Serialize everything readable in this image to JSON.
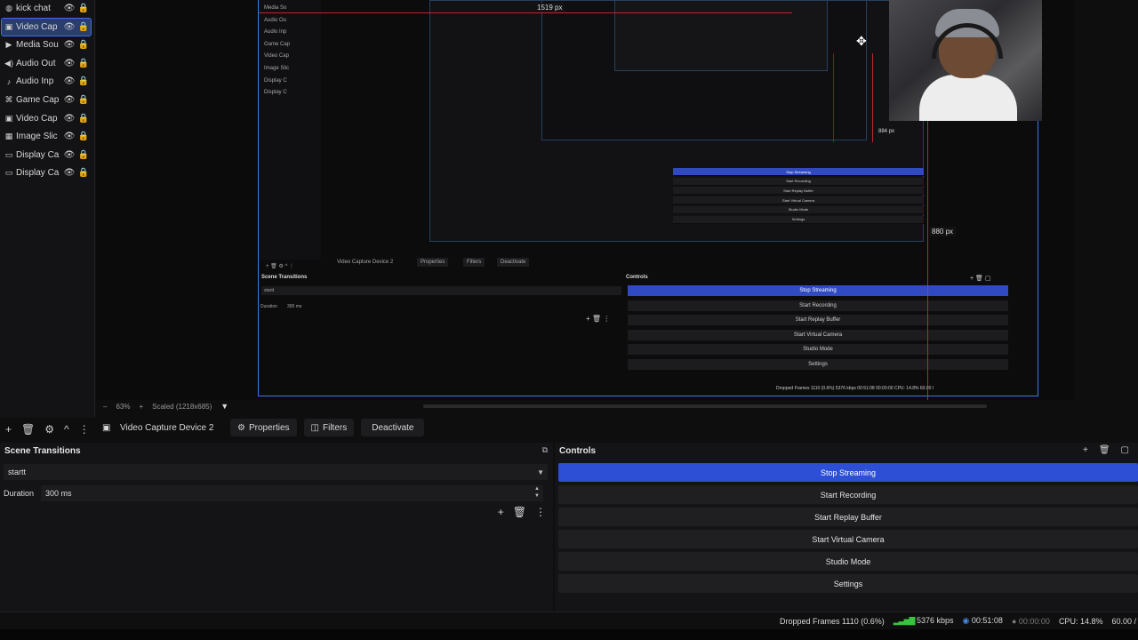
{
  "sources": [
    {
      "label": "kick chat",
      "icon": "globe-icon",
      "glyph": "◍",
      "selected": false
    },
    {
      "label": "Video Cap",
      "icon": "camera-icon",
      "glyph": "▣",
      "selected": true
    },
    {
      "label": "Media Sou",
      "icon": "play-icon",
      "glyph": "▶",
      "selected": false
    },
    {
      "label": "Audio Out",
      "icon": "speaker-icon",
      "glyph": "◀)",
      "selected": false
    },
    {
      "label": "Audio Inp",
      "icon": "microphone-icon",
      "glyph": "♪",
      "selected": false
    },
    {
      "label": "Game Cap",
      "icon": "gamepad-icon",
      "glyph": "⌘",
      "selected": false
    },
    {
      "label": "Video Cap",
      "icon": "camera-icon",
      "glyph": "▣",
      "selected": false
    },
    {
      "label": "Image Slic",
      "icon": "image-icon",
      "glyph": "▦",
      "selected": false
    },
    {
      "label": "Display Ca",
      "icon": "monitor-icon",
      "glyph": "▭",
      "selected": false
    },
    {
      "label": "Display Ca",
      "icon": "monitor-icon",
      "glyph": "▭",
      "selected": false
    }
  ],
  "preview": {
    "measure_top": "1519 px",
    "measure_right": "880 px",
    "measure_mid": "884 px",
    "zoom": "63%",
    "scaled": "Scaled (1218x685)",
    "nested": {
      "device": "Video Capture Device 2",
      "properties": "Properties",
      "filters": "Filters",
      "deactivate": "Deactivate",
      "transitions_title": "Scene Transitions",
      "transition_value": "startt",
      "duration_label": "Duration",
      "duration_value": "300 ms",
      "controls_title": "Controls",
      "controls": [
        "Stop Streaming",
        "Start Recording",
        "Start Replay Buffer",
        "Start Virtual Camera",
        "Studio Mode",
        "Settings"
      ],
      "status": "Dropped Frames 1110 (0.6%)   5376 kbps   00:51:08   00:00:00   CPU: 14.8%   60.00 /",
      "sources": [
        "Media So",
        "Audio Ou",
        "Audio Inp",
        "Game Cap",
        "Video Cap",
        "Image Slic",
        "Display C",
        "Display C"
      ]
    }
  },
  "context_bar": {
    "device": "Video Capture Device 2",
    "properties": "Properties",
    "filters": "Filters",
    "deactivate": "Deactivate"
  },
  "transitions": {
    "title": "Scene Transitions",
    "selected": "startt",
    "duration_label": "Duration",
    "duration_value": "300 ms"
  },
  "controls": {
    "title": "Controls",
    "buttons": [
      {
        "label": "Stop Streaming",
        "active": true
      },
      {
        "label": "Start Recording",
        "active": false
      },
      {
        "label": "Start Replay Buffer",
        "active": false
      },
      {
        "label": "Start Virtual Camera",
        "active": false
      },
      {
        "label": "Studio Mode",
        "active": false
      },
      {
        "label": "Settings",
        "active": false
      }
    ]
  },
  "status": {
    "dropped": "Dropped Frames 1110 (0.6%)",
    "kbps": "5376 kbps",
    "stream_time": "00:51:08",
    "rec_time": "00:00:00",
    "cpu": "CPU: 14.8%",
    "fps": "60.00 /"
  },
  "colors": {
    "accent": "#2c4fd6",
    "selection": "#3a6df0",
    "guide_red": "#e03030",
    "bitrate_green": "#38c43e"
  }
}
